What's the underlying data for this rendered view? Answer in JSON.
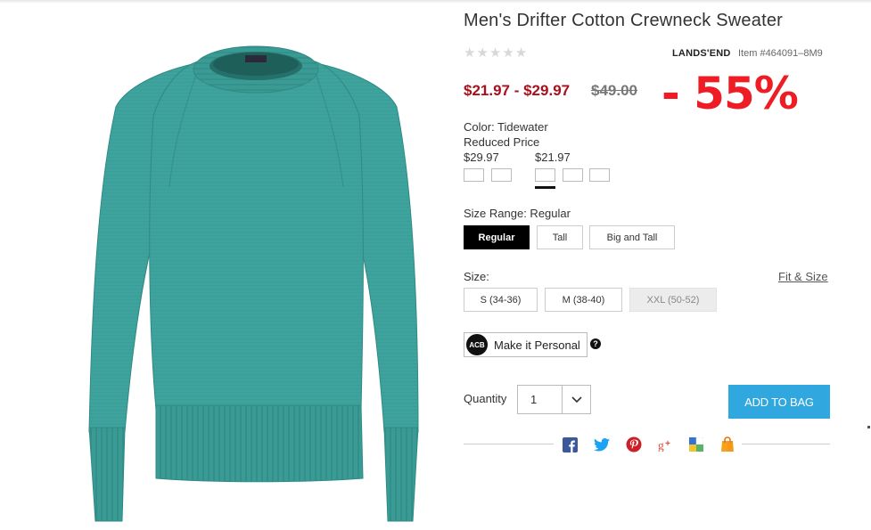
{
  "product": {
    "title": "Men's Drifter Cotton Crewneck Sweater",
    "rating_stars": "★★★★★",
    "brand": "LANDS'END",
    "item_number": "Item #464091–8M9",
    "image_alt": "Teal crewneck sweater",
    "color_hex": "#3fa39d"
  },
  "pricing": {
    "range": "$21.97 - $29.97",
    "original": "$49.00",
    "discount": "- 55%",
    "sale_color": "#a8101d",
    "discount_color": "#ee1c25"
  },
  "color": {
    "label": "Color: Tidewater",
    "reduced_label": "Reduced Price",
    "price_a": "$29.97",
    "price_b": "$21.97"
  },
  "size_range": {
    "label": "Size Range: Regular",
    "options": [
      "Regular",
      "Tall",
      "Big and Tall"
    ],
    "selected": "Regular"
  },
  "size": {
    "label": "Size:",
    "fit_link": "Fit & Size",
    "options": [
      "S (34-36)",
      "M (38-40)",
      "XXL (50-52)"
    ],
    "unavailable": "XXL (50-52)"
  },
  "personalize": {
    "monogram": "ACB",
    "label": "Make it Personal",
    "help": "?"
  },
  "quantity": {
    "label": "Quantity",
    "value": "1"
  },
  "cart": {
    "add_label": "ADD TO BAG",
    "button_color": "#30a8df"
  },
  "share": {
    "icons": [
      "facebook-icon",
      "twitter-icon",
      "pinterest-icon",
      "google-plus-icon",
      "delicious-icon",
      "shopping-bag-icon"
    ]
  }
}
